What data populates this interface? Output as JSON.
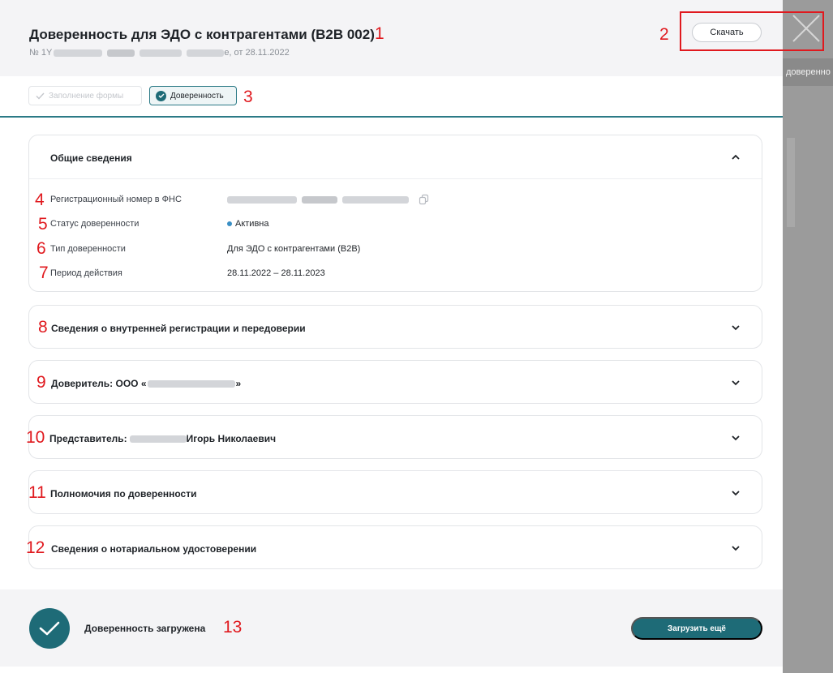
{
  "background": {
    "strip_text": "доверенно"
  },
  "header": {
    "title": "Доверенность для ЭДО с контрагентами (B2B 002)",
    "subtitle_prefix": "№ 1Y",
    "subtitle_suffix": "e, от 28.11.2022",
    "download_label": "Скачать"
  },
  "steps": [
    {
      "label": "Заполнение формы",
      "state": "completed-inactive"
    },
    {
      "label": "Доверенность",
      "state": "active"
    }
  ],
  "general": {
    "title": "Общие сведения",
    "rows": [
      {
        "label": "Регистрационный номер в ФНС",
        "value": ""
      },
      {
        "label": "Статус доверенности",
        "value": "Активна"
      },
      {
        "label": "Тип доверенности",
        "value": "Для ЭДО с контрагентами (B2B)"
      },
      {
        "label": "Период действия",
        "value": "28.11.2022 – 28.11.2023"
      }
    ]
  },
  "sections": [
    {
      "title": "Сведения о внутренней регистрации и передоверии"
    },
    {
      "title_prefix": "Доверитель: ООО «",
      "title_suffix": "»"
    },
    {
      "title_prefix": "Представитель:",
      "title_suffix": " Игорь Николаевич"
    },
    {
      "title": "Полномочия по доверенности"
    },
    {
      "title": "Сведения о нотариальном удостоверении"
    }
  ],
  "footer": {
    "status_text": "Доверенность  загружена",
    "more_label": "Загрузить ещё"
  },
  "annotations": [
    "1",
    "2",
    "3",
    "4",
    "5",
    "6",
    "7",
    "8",
    "9",
    "10",
    "11",
    "12",
    "13"
  ],
  "colors": {
    "accent": "#1e6b77",
    "annotation": "#e0191e",
    "status_dot": "#3a8fc4"
  }
}
